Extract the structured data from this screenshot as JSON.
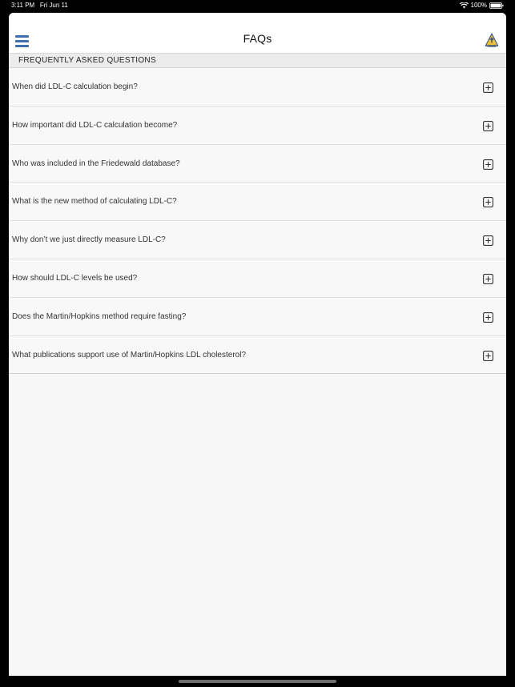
{
  "status_bar": {
    "time": "3:11 PM",
    "date": "Fri Jun 11",
    "battery_percent": "100%"
  },
  "navbar": {
    "title": "FAQs",
    "menu_icon": "hamburger-menu-icon",
    "logo_icon": "hopkins-shield-logo"
  },
  "section": {
    "header": "FREQUENTLY ASKED QUESTIONS"
  },
  "faqs": [
    {
      "question": "When did LDL-C calculation begin?"
    },
    {
      "question": "How important did LDL-C calculation become?"
    },
    {
      "question": "Who was included in the Friedewald database?"
    },
    {
      "question": "What is the new method of calculating LDL-C?"
    },
    {
      "question": "Why don’t we just directly measure LDL-C?"
    },
    {
      "question": "How should LDL-C levels be used?"
    },
    {
      "question": "Does the Martin/Hopkins method require fasting?"
    },
    {
      "question": "What publications support use of Martin/Hopkins LDL cholesterol?"
    }
  ],
  "colors": {
    "accent": "#3f6fad",
    "background": "#f7f7f7",
    "section_header_bg": "#ececec"
  }
}
